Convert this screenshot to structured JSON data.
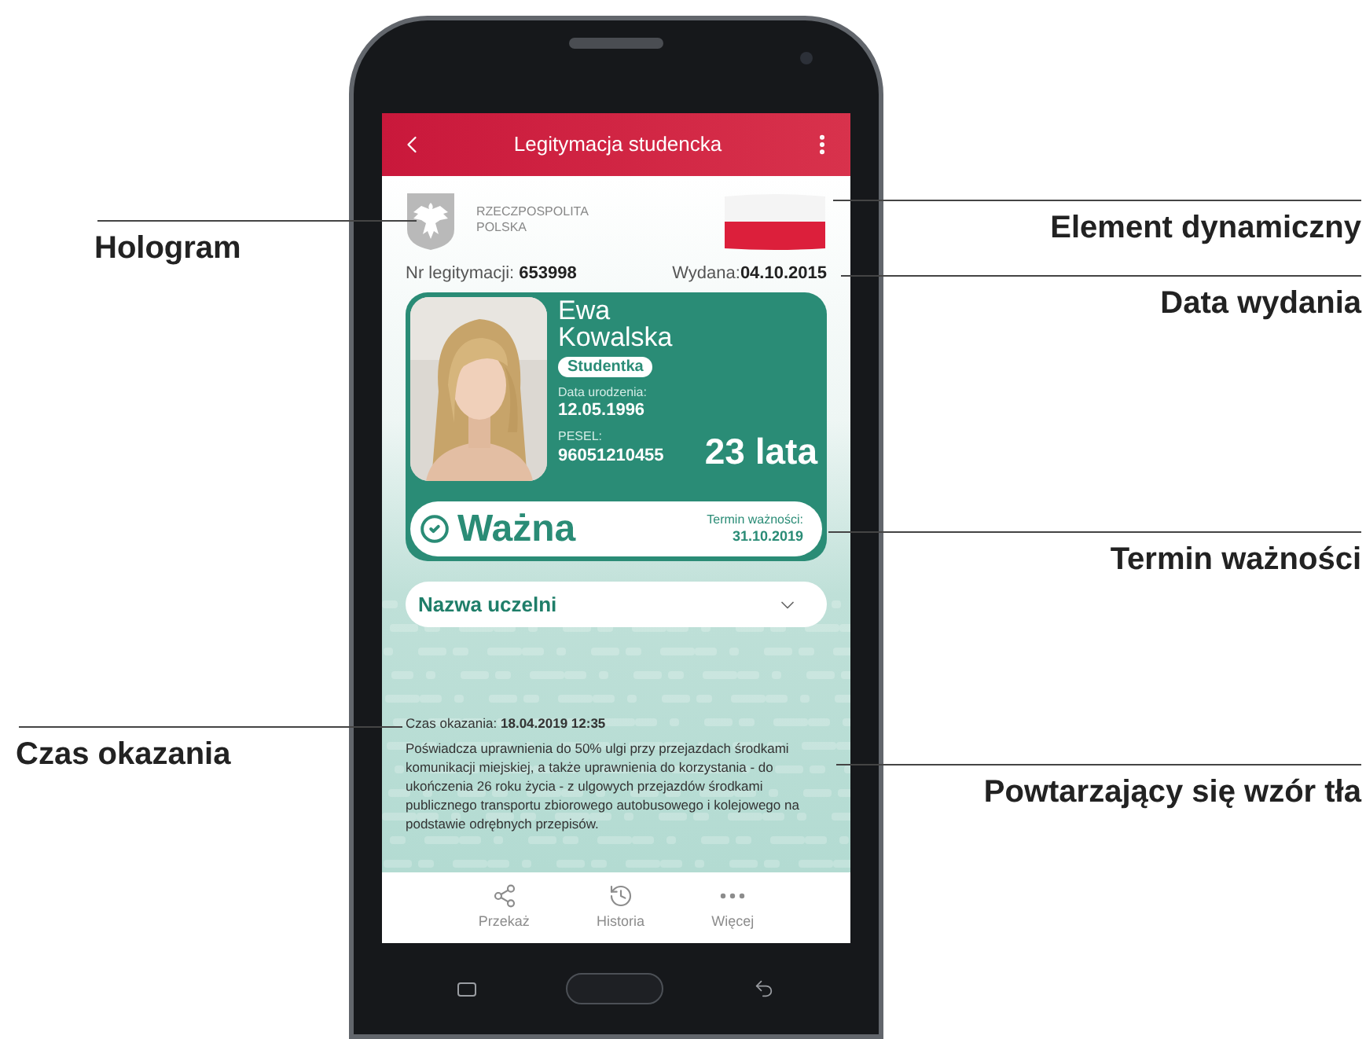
{
  "app_bar": {
    "title": "Legitymacja studencka"
  },
  "header": {
    "country_line_1": "RZECZPOSPOLITA",
    "country_line_2": "POLSKA"
  },
  "card_numbers": {
    "id": {
      "label": "Nr legitymacji:",
      "value": "653998"
    },
    "issued": {
      "label": "Wydana:",
      "value": "04.10.2015"
    }
  },
  "card": {
    "first_name": "Ewa",
    "last_name": "Kowalska",
    "role": "Studentka",
    "birth_label": "Data urodzenia:",
    "birth_date": "12.05.1996",
    "pesel_label": "PESEL:",
    "pesel": "96051210455",
    "age": "23 lata",
    "status": {
      "label": "Ważna",
      "valid": true
    },
    "expiry_label": "Termin ważności:",
    "expiry_date": "31.10.2019"
  },
  "university_dropdown": {
    "label": "Nazwa uczelni",
    "expanded": false
  },
  "shown_time": {
    "label": "Czas okazania:",
    "value": "18.04.2019 12:35"
  },
  "description": "Poświadcza uprawnienia do 50% ulgi przy przejazdach środkami komunikacji miejskiej, a także uprawnienia do korzystania - do ukończenia 26 roku życia - z ulgowych przejazdów środkami publicznego transportu zbiorowego autobusowego i kolejowego na podstawie odrębnych przepisów.",
  "bottom_nav": [
    {
      "label": "Przekaż",
      "kind": "share"
    },
    {
      "label": "Historia",
      "kind": "history"
    },
    {
      "label": "Więcej",
      "kind": "more"
    }
  ],
  "annotations": {
    "left": [
      "Hologram",
      "Czas okazania"
    ],
    "right": [
      "Element dynamiczny",
      "Data wydania",
      "Termin ważności",
      "Powtarzający się wzór tła"
    ]
  }
}
